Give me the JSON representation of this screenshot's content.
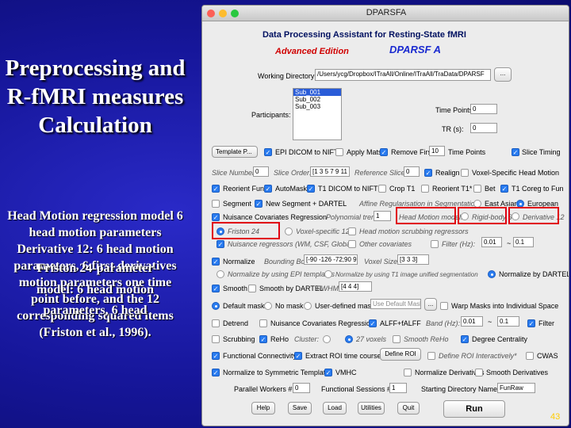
{
  "slide": {
    "title": "Preprocessing and R-fMRI measures Calculation",
    "body": "Head Motion regression model 6 head motion parameters Derivative 12: 6 head motion parameters, 6 first derivatives",
    "overlay1": "Friston 24-parameter",
    "overlay2": "model: 6 head motion",
    "overlay3": "parameters, 6 head",
    "body2": "motion parameters one time point before, and the 12 corresponding squared items (Friston et al., 1996).",
    "page_number": "43"
  },
  "window": {
    "title": "DPARSFA",
    "header": "Data Processing Assistant for Resting-State fMRI",
    "edition": "Advanced Edition",
    "product": "DPARSF A"
  },
  "workdir": {
    "label": "Working Directory:",
    "value": "/Users/ycg/Dropbox/ITraAll/Online/ITraAll/TraData/DPARSF",
    "browse": "..."
  },
  "participants": {
    "label": "Participants:",
    "items": [
      "Sub_001",
      "Sub_002",
      "Sub_003"
    ]
  },
  "timepoints": {
    "label": "Time Points:",
    "value": "0"
  },
  "tr": {
    "label": "TR (s):",
    "value": "0"
  },
  "row1": {
    "template": "Template P...",
    "epi": "EPI DICOM to NIFTI",
    "apply_mats": "Apply Mats",
    "remove_first": "Remove First",
    "remove_value": "10",
    "time_points": "Time Points",
    "slice_timing": "Slice Timing"
  },
  "row2": {
    "slice_number": "Slice Number:",
    "slice_number_value": "0",
    "slice_order": "Slice Order:",
    "slice_order_value": "[1 3 5 7 9 11",
    "ref_slice": "Reference Slice:",
    "ref_slice_value": "0",
    "realign": "Realign",
    "voxel_head": "Voxel-Specific Head Motion"
  },
  "row3": {
    "reorient": "Reorient Fun*",
    "automask": "AutoMask",
    "t1_dicom": "T1 DICOM to NIFTI",
    "crop": "Crop T1",
    "reorient_t1": "Reorient T1*",
    "bet": "Bet",
    "t1_coreg": "T1 Coreg to Fun"
  },
  "row4": {
    "segment": "Segment",
    "new_segment": "New Segment + DARTEL",
    "affine": "Affine Regularisation in Segmentation:",
    "east_asian": "East Asian",
    "european": "European"
  },
  "row5": {
    "nuisance": "Nuisance Covariates Regression",
    "poly": "Polynomial trend:",
    "poly_value": "1",
    "head_model": "Head Motion model:",
    "rigid": "Rigid-body 6",
    "deriv": "Derivative 12"
  },
  "row6": {
    "friston": "Friston 24",
    "voxel12": "Voxel-specific 12",
    "scrubbing": "Head motion scrubbing regressors"
  },
  "row7": {
    "nuisance_reg": "Nuisance regressors (WM, CSF, Global)",
    "other_cov": "Other covariates",
    "filter": "Filter (Hz):",
    "filter_low": "0.01",
    "filter_tilde": "~",
    "filter_high": "0.1"
  },
  "row8": {
    "normalize": "Normalize",
    "bbox": "Bounding Box:",
    "bbox_value": "[-90 -126 -72;90 9",
    "voxel_size": "Voxel Size:",
    "voxel_value": "[3 3 3]"
  },
  "row9": {
    "by_epi": "Normalize by using EPI templates",
    "by_t1": "Normalize by using T1 image unified segmentation",
    "by_dartel": "Normalize by DARTEL"
  },
  "row10": {
    "smooth": "Smooth",
    "smooth_dartel": "Smooth by DARTEL",
    "fwhm": "FWHM:",
    "fwhm_value": "[4 4 4]"
  },
  "row11": {
    "default_mask": "Default mask",
    "no_mask": "No mask",
    "user_mask": "User-defined mask",
    "user_mask_field": "Use Default Mask",
    "browse": "...",
    "warp": "Warp Masks into Individual Space"
  },
  "row12": {
    "detrend": "Detrend",
    "nuisance2": "Nuisance Covariates Regression",
    "alff": "ALFF+fALFF",
    "band": "Band (Hz):",
    "band_low": "0.01",
    "band_tilde": "~",
    "band_high": "0.1",
    "filter": "Filter"
  },
  "row13": {
    "scrubbing": "Scrubbing",
    "reho": "ReHo",
    "cluster": "Cluster:",
    "cluster_value": "27 voxels",
    "smooth_reho": "Smooth ReHo",
    "degree": "Degree Centrality"
  },
  "row14": {
    "fc": "Functional Connectivity",
    "extract": "Extract ROI time courses",
    "define_roi": "Define ROI",
    "define_interactive": "Define ROI Interactively*",
    "cwas": "CWAS"
  },
  "row15": {
    "normalize_sym": "Normalize to Symmetric Template",
    "vmhc": "VMHC",
    "norm_deriv": "Normalize Derivatives",
    "smooth_deriv": "Smooth Derivatives"
  },
  "row16": {
    "workers": "Parallel Workers #:",
    "workers_value": "0",
    "sessions": "Functional Sessions #:",
    "sessions_value": "1",
    "start_dir": "Starting Directory Name:",
    "start_dir_value": "FunRaw"
  },
  "buttons": {
    "help": "Help",
    "save": "Save",
    "load": "Load",
    "utilities": "Utilities",
    "quit": "Quit",
    "run": "Run"
  }
}
